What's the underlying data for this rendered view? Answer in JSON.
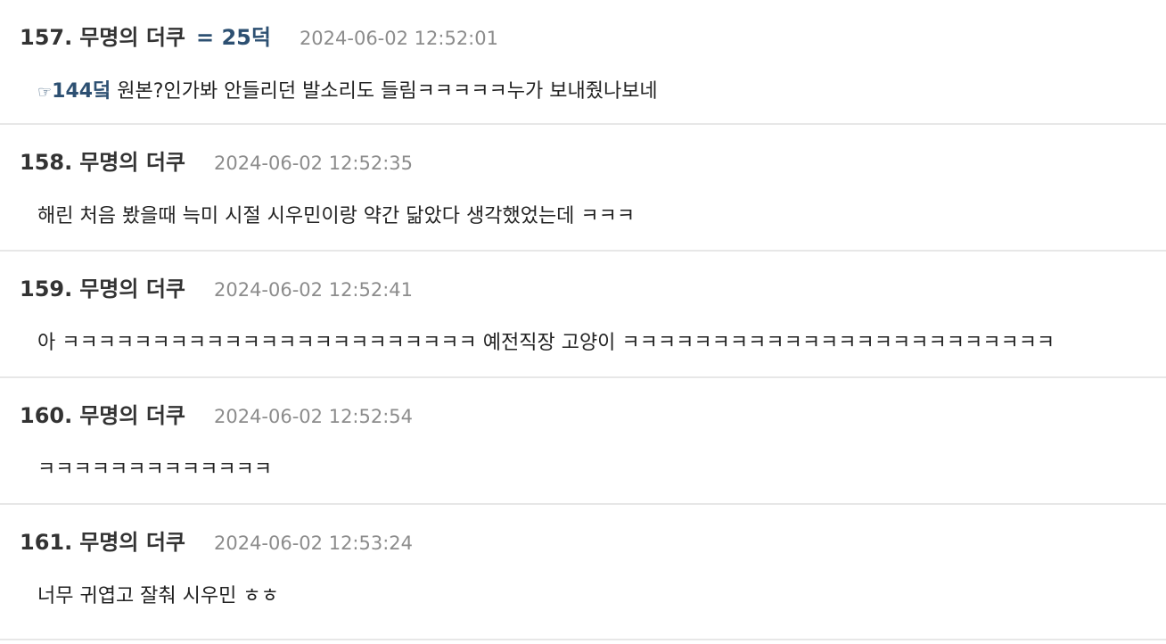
{
  "comments": [
    {
      "number": "157.",
      "author": "무명의 더쿠",
      "vote": "= 25덕",
      "date": "2024-06-02 12:52:01",
      "reply_icon": "☞",
      "reply_ref": "144덬",
      "body": " 원본?인가봐 안들리던 발소리도 들림ㅋㅋㅋㅋㅋ누가 보내줬나보네"
    },
    {
      "number": "158.",
      "author": "무명의 더쿠",
      "date": "2024-06-02 12:52:35",
      "body": "해린 처음 봤을때 늑미 시절 시우민이랑 약간 닮았다 생각했었는데 ㅋㅋㅋ"
    },
    {
      "number": "159.",
      "author": "무명의 더쿠",
      "date": "2024-06-02 12:52:41",
      "body": "아 ㅋㅋㅋㅋㅋㅋㅋㅋㅋㅋㅋㅋㅋㅋㅋㅋㅋㅋㅋㅋㅋㅋㅋ 예전직장 고양이 ㅋㅋㅋㅋㅋㅋㅋㅋㅋㅋㅋㅋㅋㅋㅋㅋㅋㅋㅋㅋㅋㅋㅋㅋ"
    },
    {
      "number": "160.",
      "author": "무명의 더쿠",
      "date": "2024-06-02 12:52:54",
      "body": "ㅋㅋㅋㅋㅋㅋㅋㅋㅋㅋㅋㅋㅋ"
    },
    {
      "number": "161.",
      "author": "무명의 더쿠",
      "date": "2024-06-02 12:53:24",
      "body": "너무 귀엽고 잘춰 시우민 ㅎㅎ"
    }
  ]
}
